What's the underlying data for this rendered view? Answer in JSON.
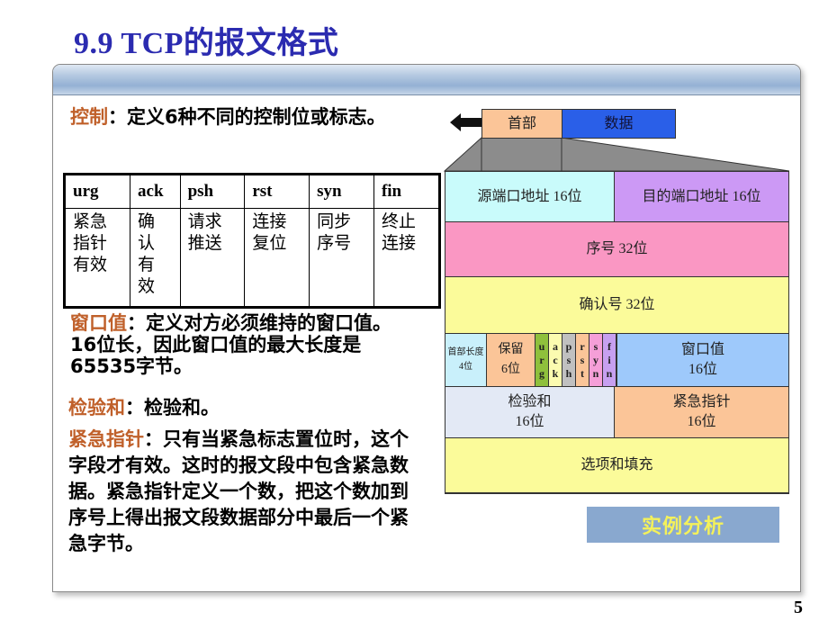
{
  "slide": {
    "title": "9.9  TCP的报文格式",
    "page_number": "5"
  },
  "control": {
    "keyword": "控制",
    "text": "：定义6种不同的控制位或标志。"
  },
  "flags_table": {
    "headers": [
      "urg",
      "ack",
      "psh",
      "rst",
      "syn",
      "fin"
    ],
    "descriptions": [
      "紧急指针有效",
      "确认有效",
      "请求推送",
      "连接复位",
      "同步序号",
      "终止连接"
    ]
  },
  "window": {
    "keyword": "窗口值",
    "text": "：定义对方必须维持的窗口值。16位长，因此窗口值的最大长度是65535字节。"
  },
  "checksum": {
    "keyword": "检验和",
    "text": "：检验和。"
  },
  "urgent": {
    "keyword": "紧急指针",
    "text": "：只有当紧急标志置位时，这个字段才有效。这时的报文段中包含紧急数据。紧急指针定义一个数，把这个数加到序号上得出报文段数据部分中最后一个紧急字节。"
  },
  "diagram": {
    "segment": {
      "header_label": "首部",
      "data_label": "数据"
    },
    "fields": {
      "src_port": "源端口地址 16位",
      "dst_port": "目的端口地址 16位",
      "seq": "序号 32位",
      "ack": "确认号 32位",
      "hdr_len_line1": "首部长度",
      "hdr_len_line2": "4位",
      "reserved_line1": "保留",
      "reserved_line2": "6位",
      "flag_letters": [
        [
          "u",
          "r",
          "g"
        ],
        [
          "a",
          "c",
          "k"
        ],
        [
          "p",
          "s",
          "h"
        ],
        [
          "r",
          "s",
          "t"
        ],
        [
          "s",
          "y",
          "n"
        ],
        [
          "f",
          "i",
          "n"
        ]
      ],
      "window_line1": "窗口值",
      "window_line2": "16位",
      "checksum_line1": "检验和",
      "checksum_line2": "16位",
      "urgent_line1": "紧急指针",
      "urgent_line2": "16位",
      "options": "选项和填充"
    },
    "colors": {
      "header": "#fbc598",
      "data": "#2a5fe8",
      "src_port": "#c9fbfb",
      "dst_port": "#cc99f5",
      "seq": "#fa97c3",
      "ack": "#fbfb9a",
      "hdr_len": "#c9f0fb",
      "reserved": "#fbc598",
      "flags": [
        "#8fc03c",
        "#fbfbb0",
        "#c0c0c0",
        "#fbc598",
        "#f59fd8",
        "#c7a0f0"
      ],
      "window": "#9ec9fb",
      "checksum": "#e3e9f5",
      "urgent": "#fbc598",
      "options": "#fbfb9a",
      "wedge": "#8c8c8c"
    }
  },
  "example_button": {
    "label": "实例分析"
  }
}
